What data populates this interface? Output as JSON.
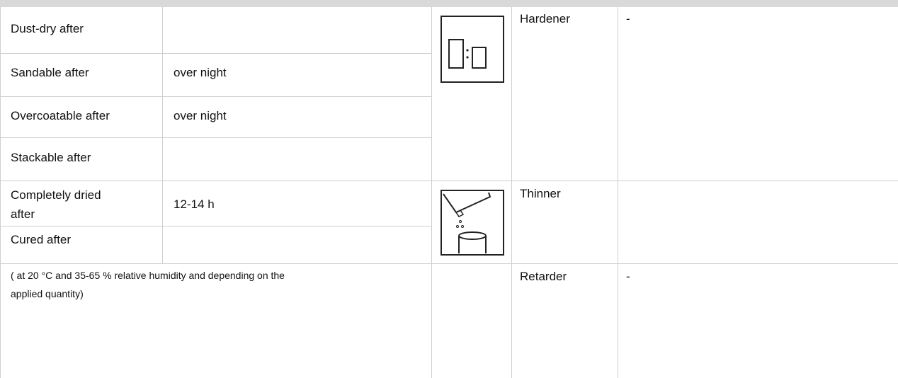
{
  "drying": {
    "rows": [
      {
        "label": "Dust-dry after",
        "value": ""
      },
      {
        "label": "Sandable after",
        "value": "over night"
      },
      {
        "label": "Overcoatable after",
        "value": "over night"
      },
      {
        "label": "Stackable after",
        "value": ""
      },
      {
        "label_line1": "Completely dried",
        "label_line2": "after",
        "value": "12-14 h"
      },
      {
        "label": "Cured after",
        "value": ""
      }
    ],
    "note_line1": "( at 20 °C and 35-65 % relative humidity and depending on the",
    "note_line2": "applied quantity)"
  },
  "additives": [
    {
      "label": "Hardener",
      "value": "-",
      "icon": "mixing-ratio-icon"
    },
    {
      "label": "Thinner",
      "value": "",
      "icon": "thinner-pouring-icon"
    },
    {
      "label": "Retarder",
      "value": "-"
    }
  ]
}
